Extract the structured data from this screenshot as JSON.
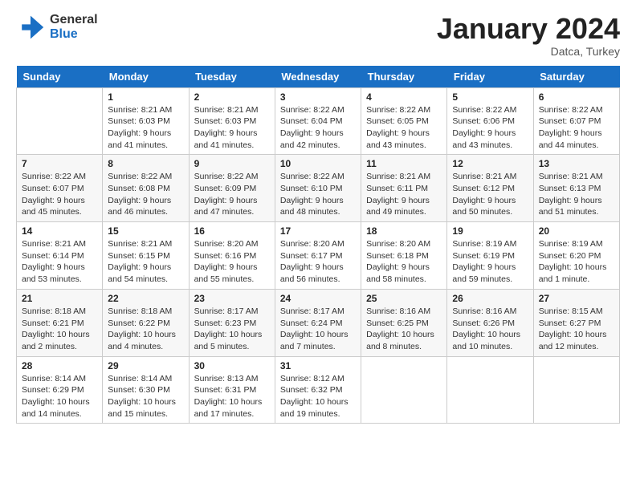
{
  "logo": {
    "line1": "General",
    "line2": "Blue"
  },
  "title": "January 2024",
  "location": "Datca, Turkey",
  "header": {
    "days": [
      "Sunday",
      "Monday",
      "Tuesday",
      "Wednesday",
      "Thursday",
      "Friday",
      "Saturday"
    ]
  },
  "weeks": [
    [
      {
        "day": "",
        "sunrise": "",
        "sunset": "",
        "daylight": ""
      },
      {
        "day": "1",
        "sunrise": "Sunrise: 8:21 AM",
        "sunset": "Sunset: 6:03 PM",
        "daylight": "Daylight: 9 hours and 41 minutes."
      },
      {
        "day": "2",
        "sunrise": "Sunrise: 8:21 AM",
        "sunset": "Sunset: 6:03 PM",
        "daylight": "Daylight: 9 hours and 41 minutes."
      },
      {
        "day": "3",
        "sunrise": "Sunrise: 8:22 AM",
        "sunset": "Sunset: 6:04 PM",
        "daylight": "Daylight: 9 hours and 42 minutes."
      },
      {
        "day": "4",
        "sunrise": "Sunrise: 8:22 AM",
        "sunset": "Sunset: 6:05 PM",
        "daylight": "Daylight: 9 hours and 43 minutes."
      },
      {
        "day": "5",
        "sunrise": "Sunrise: 8:22 AM",
        "sunset": "Sunset: 6:06 PM",
        "daylight": "Daylight: 9 hours and 43 minutes."
      },
      {
        "day": "6",
        "sunrise": "Sunrise: 8:22 AM",
        "sunset": "Sunset: 6:07 PM",
        "daylight": "Daylight: 9 hours and 44 minutes."
      }
    ],
    [
      {
        "day": "7",
        "sunrise": "Sunrise: 8:22 AM",
        "sunset": "Sunset: 6:07 PM",
        "daylight": "Daylight: 9 hours and 45 minutes."
      },
      {
        "day": "8",
        "sunrise": "Sunrise: 8:22 AM",
        "sunset": "Sunset: 6:08 PM",
        "daylight": "Daylight: 9 hours and 46 minutes."
      },
      {
        "day": "9",
        "sunrise": "Sunrise: 8:22 AM",
        "sunset": "Sunset: 6:09 PM",
        "daylight": "Daylight: 9 hours and 47 minutes."
      },
      {
        "day": "10",
        "sunrise": "Sunrise: 8:22 AM",
        "sunset": "Sunset: 6:10 PM",
        "daylight": "Daylight: 9 hours and 48 minutes."
      },
      {
        "day": "11",
        "sunrise": "Sunrise: 8:21 AM",
        "sunset": "Sunset: 6:11 PM",
        "daylight": "Daylight: 9 hours and 49 minutes."
      },
      {
        "day": "12",
        "sunrise": "Sunrise: 8:21 AM",
        "sunset": "Sunset: 6:12 PM",
        "daylight": "Daylight: 9 hours and 50 minutes."
      },
      {
        "day": "13",
        "sunrise": "Sunrise: 8:21 AM",
        "sunset": "Sunset: 6:13 PM",
        "daylight": "Daylight: 9 hours and 51 minutes."
      }
    ],
    [
      {
        "day": "14",
        "sunrise": "Sunrise: 8:21 AM",
        "sunset": "Sunset: 6:14 PM",
        "daylight": "Daylight: 9 hours and 53 minutes."
      },
      {
        "day": "15",
        "sunrise": "Sunrise: 8:21 AM",
        "sunset": "Sunset: 6:15 PM",
        "daylight": "Daylight: 9 hours and 54 minutes."
      },
      {
        "day": "16",
        "sunrise": "Sunrise: 8:20 AM",
        "sunset": "Sunset: 6:16 PM",
        "daylight": "Daylight: 9 hours and 55 minutes."
      },
      {
        "day": "17",
        "sunrise": "Sunrise: 8:20 AM",
        "sunset": "Sunset: 6:17 PM",
        "daylight": "Daylight: 9 hours and 56 minutes."
      },
      {
        "day": "18",
        "sunrise": "Sunrise: 8:20 AM",
        "sunset": "Sunset: 6:18 PM",
        "daylight": "Daylight: 9 hours and 58 minutes."
      },
      {
        "day": "19",
        "sunrise": "Sunrise: 8:19 AM",
        "sunset": "Sunset: 6:19 PM",
        "daylight": "Daylight: 9 hours and 59 minutes."
      },
      {
        "day": "20",
        "sunrise": "Sunrise: 8:19 AM",
        "sunset": "Sunset: 6:20 PM",
        "daylight": "Daylight: 10 hours and 1 minute."
      }
    ],
    [
      {
        "day": "21",
        "sunrise": "Sunrise: 8:18 AM",
        "sunset": "Sunset: 6:21 PM",
        "daylight": "Daylight: 10 hours and 2 minutes."
      },
      {
        "day": "22",
        "sunrise": "Sunrise: 8:18 AM",
        "sunset": "Sunset: 6:22 PM",
        "daylight": "Daylight: 10 hours and 4 minutes."
      },
      {
        "day": "23",
        "sunrise": "Sunrise: 8:17 AM",
        "sunset": "Sunset: 6:23 PM",
        "daylight": "Daylight: 10 hours and 5 minutes."
      },
      {
        "day": "24",
        "sunrise": "Sunrise: 8:17 AM",
        "sunset": "Sunset: 6:24 PM",
        "daylight": "Daylight: 10 hours and 7 minutes."
      },
      {
        "day": "25",
        "sunrise": "Sunrise: 8:16 AM",
        "sunset": "Sunset: 6:25 PM",
        "daylight": "Daylight: 10 hours and 8 minutes."
      },
      {
        "day": "26",
        "sunrise": "Sunrise: 8:16 AM",
        "sunset": "Sunset: 6:26 PM",
        "daylight": "Daylight: 10 hours and 10 minutes."
      },
      {
        "day": "27",
        "sunrise": "Sunrise: 8:15 AM",
        "sunset": "Sunset: 6:27 PM",
        "daylight": "Daylight: 10 hours and 12 minutes."
      }
    ],
    [
      {
        "day": "28",
        "sunrise": "Sunrise: 8:14 AM",
        "sunset": "Sunset: 6:29 PM",
        "daylight": "Daylight: 10 hours and 14 minutes."
      },
      {
        "day": "29",
        "sunrise": "Sunrise: 8:14 AM",
        "sunset": "Sunset: 6:30 PM",
        "daylight": "Daylight: 10 hours and 15 minutes."
      },
      {
        "day": "30",
        "sunrise": "Sunrise: 8:13 AM",
        "sunset": "Sunset: 6:31 PM",
        "daylight": "Daylight: 10 hours and 17 minutes."
      },
      {
        "day": "31",
        "sunrise": "Sunrise: 8:12 AM",
        "sunset": "Sunset: 6:32 PM",
        "daylight": "Daylight: 10 hours and 19 minutes."
      },
      {
        "day": "",
        "sunrise": "",
        "sunset": "",
        "daylight": ""
      },
      {
        "day": "",
        "sunrise": "",
        "sunset": "",
        "daylight": ""
      },
      {
        "day": "",
        "sunrise": "",
        "sunset": "",
        "daylight": ""
      }
    ]
  ]
}
